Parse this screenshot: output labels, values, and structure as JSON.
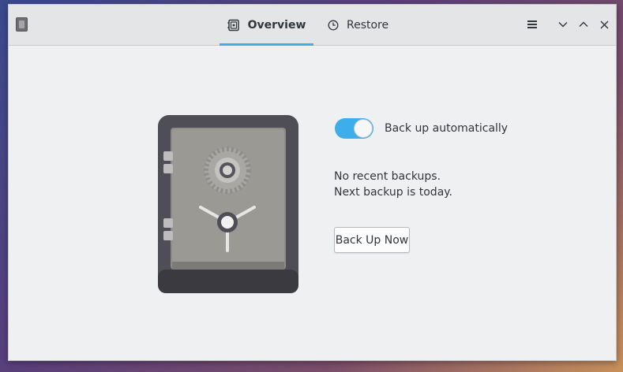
{
  "colors": {
    "accent": "#3daee9",
    "window_bg": "#eff0f1",
    "header_bg": "#e3e5e7",
    "text": "#31363b"
  },
  "header": {
    "app_icon": "safe-app-icon",
    "tabs": [
      {
        "label": "Overview",
        "icon": "safe-icon",
        "active": true
      },
      {
        "label": "Restore",
        "icon": "clock-icon",
        "active": false
      }
    ],
    "controls": [
      "menu-icon",
      "minimize-icon",
      "maximize-icon",
      "close-icon"
    ]
  },
  "main": {
    "illustration": "safe-illustration",
    "toggle": {
      "label": "Back up automatically",
      "on": true
    },
    "status": {
      "line1": "No recent backups.",
      "line2": "Next backup is today."
    },
    "backup_button": "Back Up Now"
  }
}
